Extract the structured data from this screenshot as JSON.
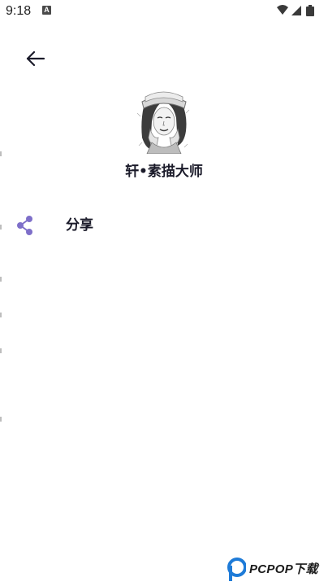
{
  "status_bar": {
    "time": "9:18",
    "notification_letter": "A",
    "icons": [
      "wifi-icon",
      "cell-signal-icon",
      "battery-icon"
    ]
  },
  "header": {
    "back_icon": "arrow-left-icon"
  },
  "app": {
    "name": "轩•素描大师",
    "logo_icon": "sketch-portrait-logo"
  },
  "menu": {
    "items": [
      {
        "label": "分享",
        "icon": "share-icon",
        "icon_color": "#7e6fc9"
      }
    ]
  },
  "watermark": {
    "text": "PCPOP下载",
    "color": "#1e7bd8"
  },
  "colors": {
    "background": "#ffffff",
    "text": "#1b1b2a",
    "accent": "#7e6fc9"
  }
}
